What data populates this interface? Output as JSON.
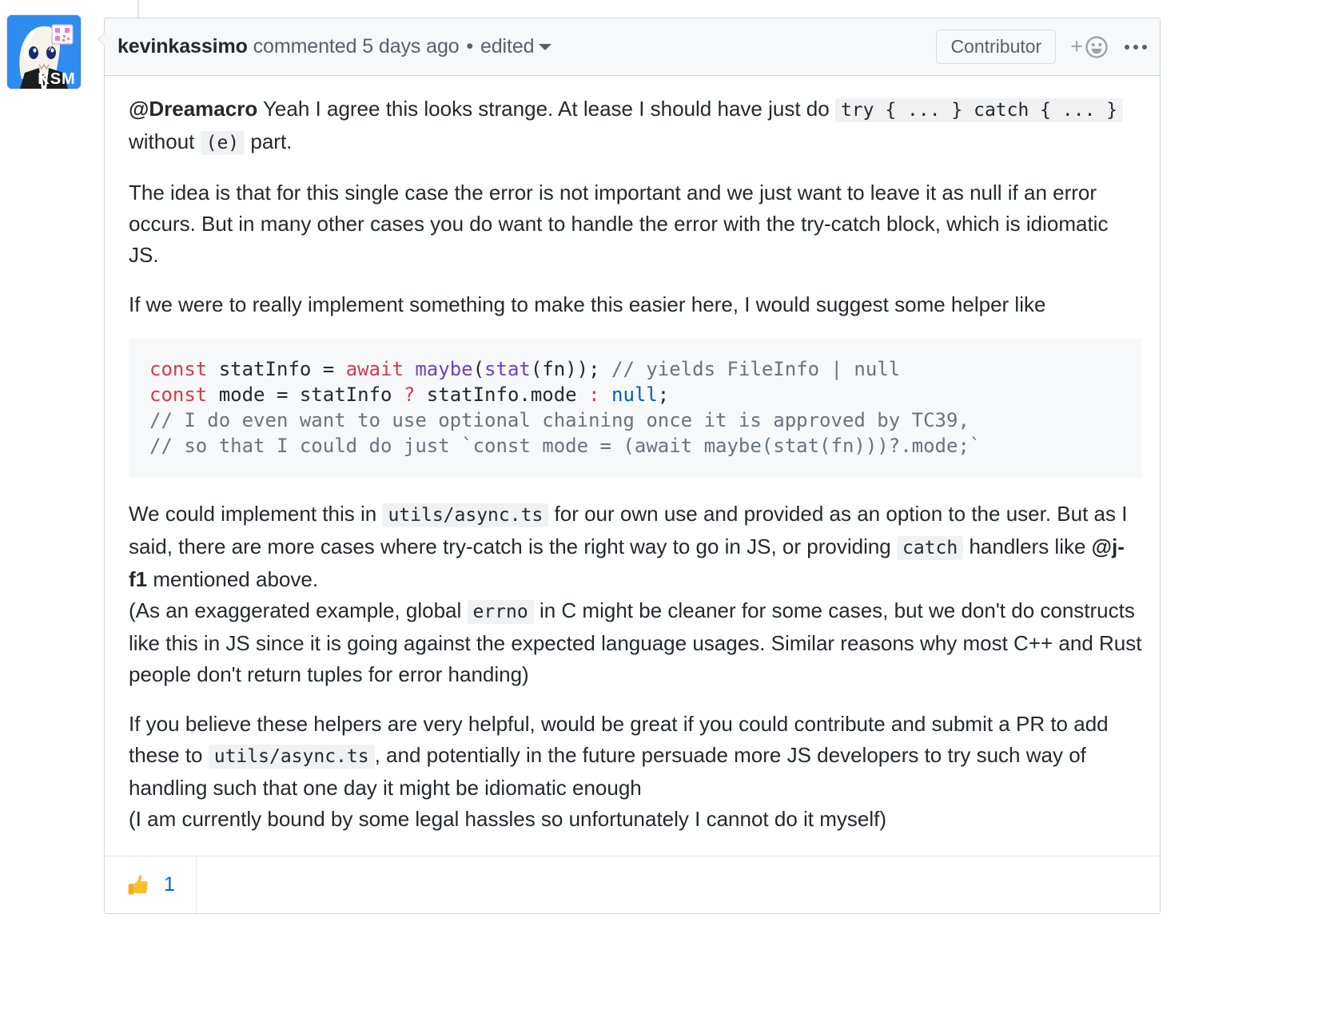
{
  "avatar": {
    "alt_text": "KSM",
    "badge_text": "KSM"
  },
  "header": {
    "author": "kevinkassimo",
    "action": "commented",
    "timestamp": "5 days ago",
    "separator": "•",
    "edited_label": "edited",
    "caret_icon": "chevron-down-icon",
    "badge": "Contributor",
    "add_reaction_plus": "+",
    "add_reaction_icon": "smiley-face-icon",
    "menu_icon": "kebab-horizontal-icon"
  },
  "body": {
    "p1": {
      "mention": "@Dreamacro",
      "text_a": " Yeah I agree this looks strange. At lease I should have just do ",
      "code_a": "try { ... } catch { ... }",
      "text_b": " without ",
      "code_b": "(e)",
      "text_c": " part."
    },
    "p2": "The idea is that for this single case the error is not important and we just want to leave it as null if an error occurs. But in many other cases you do want to handle the error with the try-catch block, which is idiomatic JS.",
    "p3": "If we were to really implement something to make this easier here, I would suggest some helper like",
    "code_block": {
      "line1": {
        "kw1": "const",
        "var1": " statInfo = ",
        "kw2": "await",
        "sp1": " ",
        "fn1": "maybe",
        "paren1": "(",
        "fn2": "stat",
        "rest": "(fn)); ",
        "comment": "// yields FileInfo | null"
      },
      "line2": {
        "kw1": "const",
        "var1": " mode = statInfo ",
        "op1": "?",
        "var2": " statInfo.mode ",
        "op2": ":",
        "sp": " ",
        "constant": "null",
        "semi": ";"
      },
      "line3": "// I do even want to use optional chaining once it is approved by TC39,",
      "line4": "// so that I could do just `const mode = (await maybe(stat(fn)))?.mode;`"
    },
    "p4": {
      "text_a": "We could implement this in ",
      "code_a": "utils/async.ts",
      "text_b": " for our own use and provided as an option to the user. But as I said, there are more cases where try-catch is the right way to go in JS, or providing ",
      "code_b": "catch",
      "text_c": " handlers like ",
      "mention": "@j-f1",
      "text_d": " mentioned above."
    },
    "p5": {
      "text_a": "(As an exaggerated example, global ",
      "code_a": "errno",
      "text_b": " in C might be cleaner for some cases, but we don't do constructs like this in JS since it is going against the expected language usages. Similar reasons why most C++ and Rust people don't return tuples for error handing)"
    },
    "p6": {
      "text_a": "If you believe these helpers are very helpful, would be great if you could contribute and submit a PR to add these to ",
      "code_a": "utils/async.ts",
      "text_b": ", and potentially in the future persuade more JS developers to try such way of handling such that one day it might be idiomatic enough"
    },
    "p7": "(I am currently bound by some legal hassles so unfortunately I cannot do it myself)"
  },
  "reactions": {
    "thumbsup_icon": "thumbs-up-emoji",
    "thumbsup_count": "1"
  },
  "colors": {
    "link_blue": "#0366d6",
    "keyword_red": "#d73a49",
    "function_purple": "#6f42c1",
    "comment_gray": "#6a737d",
    "constant_blue": "#005cc5",
    "border_gray": "#d1d5da",
    "header_bg": "#f6f8fa"
  }
}
